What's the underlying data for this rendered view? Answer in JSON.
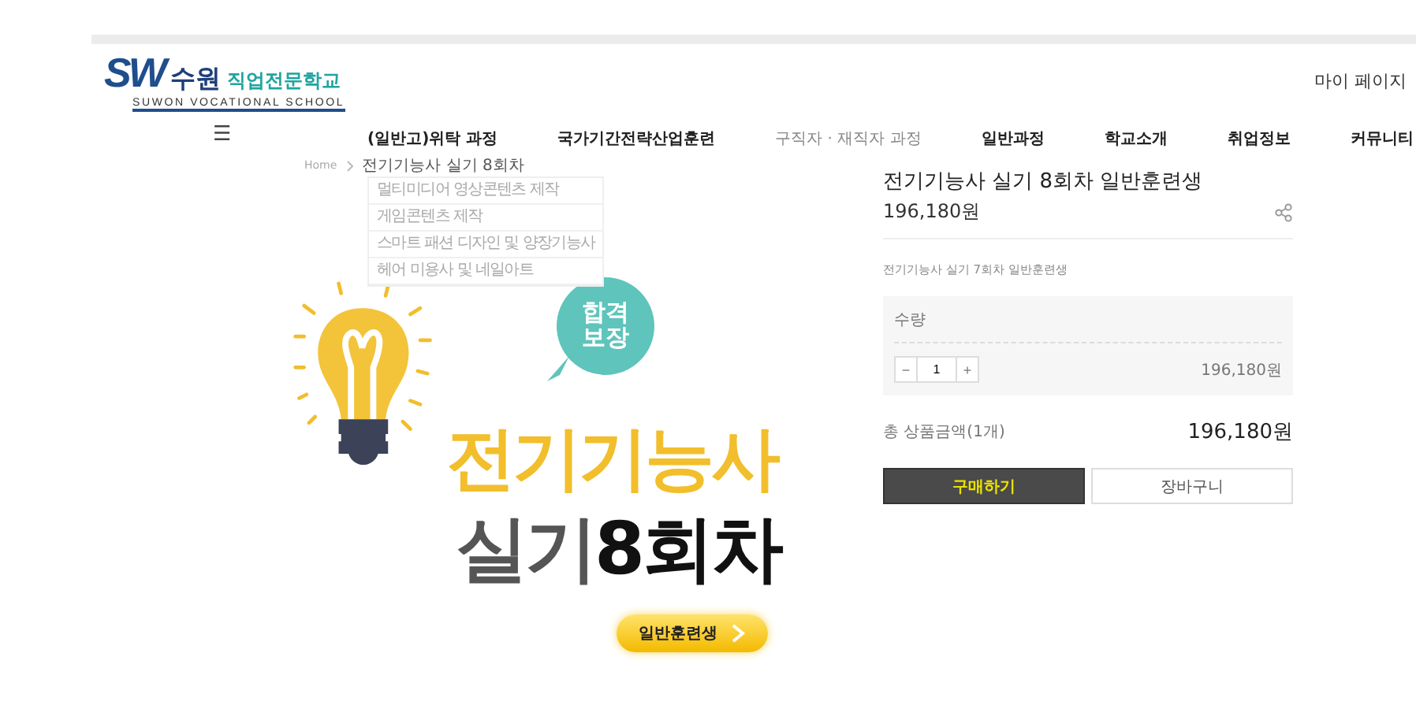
{
  "header": {
    "logo": {
      "mark": "SW",
      "name": "수원",
      "school": "직업전문학교",
      "english": "SUWON VOCATIONAL SCHOOL"
    },
    "my_page": "마이 페이지"
  },
  "nav": {
    "menu_icon": "☰",
    "items": [
      {
        "label": "(일반고)위탁 과정",
        "active": false,
        "children": [
          "멀티미디어 영상콘텐츠 제작",
          "게임콘텐츠 제작",
          "스마트 패션 디자인 및 양장기능사",
          "헤어 미용사 및 네일아트"
        ]
      },
      {
        "label": "국가기간전략산업훈련",
        "active": false
      },
      {
        "label": "구직자 · 재직자 과정",
        "active": true
      },
      {
        "label": "일반과정",
        "active": false
      },
      {
        "label": "학교소개",
        "active": false
      },
      {
        "label": "취업정보",
        "active": false
      },
      {
        "label": "커뮤니티",
        "active": false
      }
    ]
  },
  "breadcrumb": [
    "Home",
    "전기기능사 실기 8회차"
  ],
  "banner": {
    "bubble": [
      "합격",
      "보장"
    ],
    "headline": "전기기능사",
    "subline_word": "실기",
    "subline_rest": "8회차",
    "button": "일반훈련생"
  },
  "product": {
    "title": "전기기능사 실기 8회차 일반훈련생",
    "price": "196,180원",
    "description": "전기기능사 실기 7회차 일반훈련생",
    "option": {
      "label": "수량",
      "minus": "−",
      "quantity": "1",
      "plus": "+",
      "amount": "196,180원"
    },
    "total": {
      "label": "총 상품금액(1개)",
      "amount": "196,180원"
    },
    "buttons": [
      {
        "label": "구매하기",
        "kind": "primary"
      },
      {
        "label": "장바구니",
        "kind": "secondary"
      }
    ]
  }
}
